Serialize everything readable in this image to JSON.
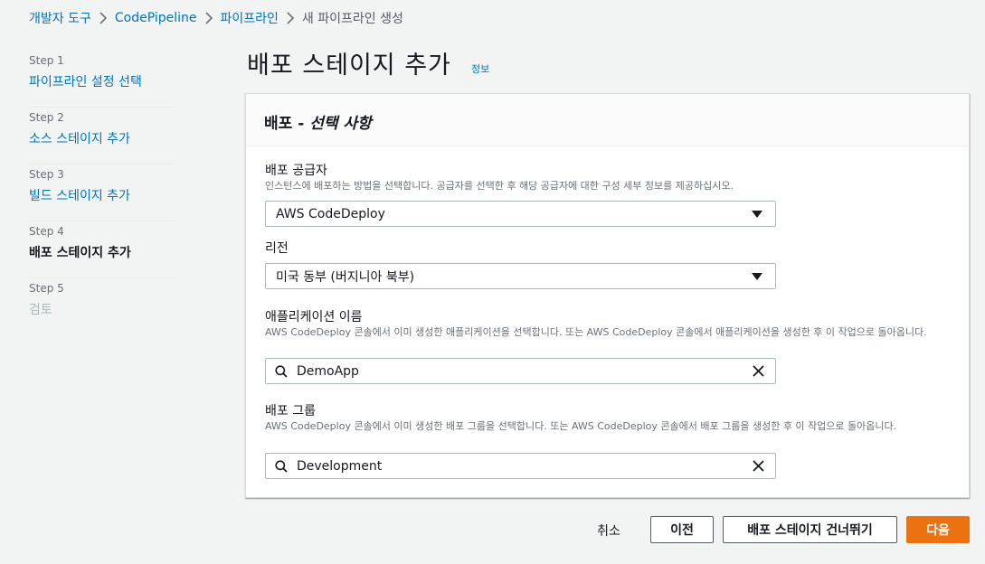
{
  "breadcrumb": {
    "items": [
      "개발자 도구",
      "CodePipeline",
      "파이프라인",
      "새 파이프라인 생성"
    ]
  },
  "steps": [
    {
      "num": "Step 1",
      "label": "파이프라인 설정 선택",
      "state": "link"
    },
    {
      "num": "Step 2",
      "label": "소스 스테이지 추가",
      "state": "link"
    },
    {
      "num": "Step 3",
      "label": "빌드 스테이지 추가",
      "state": "link"
    },
    {
      "num": "Step 4",
      "label": "배포 스테이지 추가",
      "state": "active"
    },
    {
      "num": "Step 5",
      "label": "검토",
      "state": "disabled"
    }
  ],
  "page": {
    "title": "배포 스테이지 추가",
    "info_link": "정보"
  },
  "panel": {
    "title_main": "배포 - ",
    "title_optional": "선택 사항",
    "provider": {
      "label": "배포 공급자",
      "description": "인스턴스에 배포하는 방법을 선택합니다. 공급자를 선택한 후 해당 공급자에 대한 구성 세부 정보를 제공하십시오.",
      "value": "AWS CodeDeploy"
    },
    "region": {
      "label": "리전",
      "value": "미국 동부 (버지니아 북부)"
    },
    "application": {
      "label": "애플리케이션 이름",
      "description": "AWS CodeDeploy 콘솔에서 이미 생성한 애플리케이션을 선택합니다. 또는 AWS CodeDeploy 콘솔에서 애플리케이션을 생성한 후 이 작업으로 돌아옵니다.",
      "value": "DemoApp"
    },
    "group": {
      "label": "배포 그룹",
      "description": "AWS CodeDeploy 콘솔에서 이미 생성한 배포 그룹을 선택합니다. 또는 AWS CodeDeploy 콘솔에서 배포 그룹을 생성한 후 이 작업으로 돌아옵니다.",
      "value": "Development"
    }
  },
  "footer": {
    "cancel": "취소",
    "previous": "이전",
    "skip": "배포 스테이지 건너뛰기",
    "next": "다음"
  },
  "colors": {
    "link": "#0073bb",
    "primary_button": "#ec7211",
    "background": "#f2f3f3"
  }
}
